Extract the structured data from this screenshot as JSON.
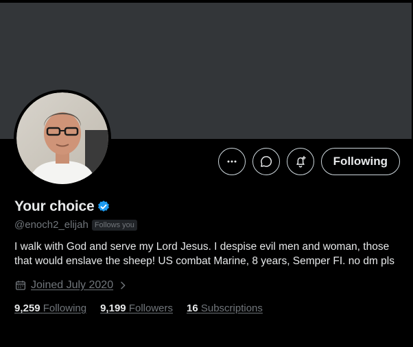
{
  "profile": {
    "name": "Your choice",
    "handle": "@enoch2_elijah",
    "follows_you": "Follows you",
    "bio": "I walk with God and serve my Lord Jesus. I despise evil men and woman, those that would enslave the sheep!  US combat Marine, 8 years, Semper FI. no dm pls",
    "joined": "Joined July 2020"
  },
  "actions": {
    "following_label": "Following"
  },
  "stats": {
    "following_count": "9,259",
    "following_label": "Following",
    "followers_count": "9,199",
    "followers_label": "Followers",
    "subscriptions_count": "16",
    "subscriptions_label": "Subscriptions"
  },
  "icons": {
    "more": "more-icon",
    "message": "message-icon",
    "notify": "bell-plus-icon",
    "verified": "verified-badge-icon",
    "calendar": "calendar-icon",
    "chevron": "chevron-right-icon"
  },
  "colors": {
    "background": "#000000",
    "banner": "#333639",
    "text_primary": "#e7e9ea",
    "text_secondary": "#71767b",
    "verified_blue": "#1d9bf0",
    "button_border": "#cfd9de"
  }
}
